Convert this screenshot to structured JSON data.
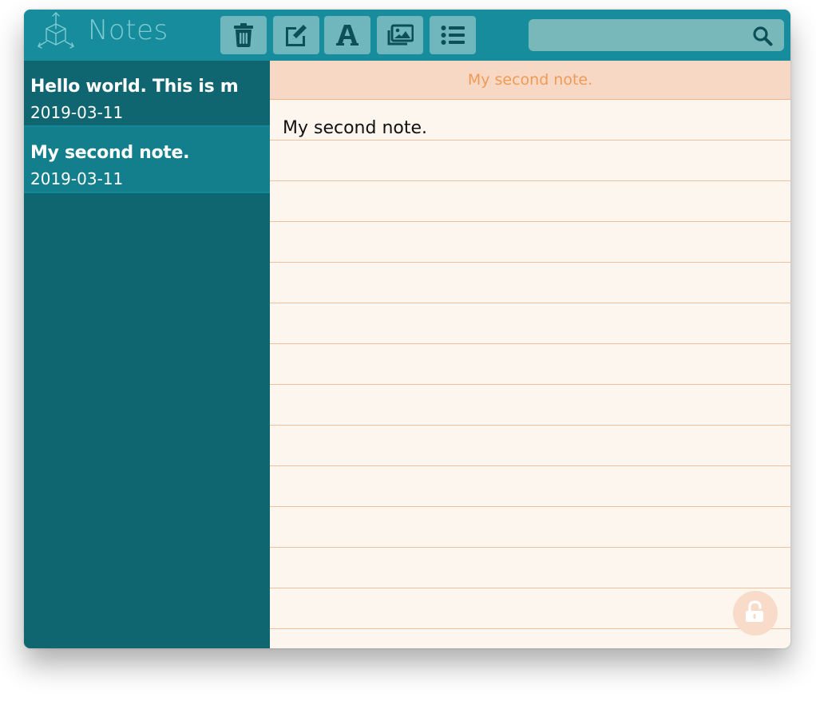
{
  "app": {
    "title": "Notes",
    "accent": "#168c9c",
    "sidebar_bg": "#106670"
  },
  "toolbar": {
    "buttons": [
      {
        "icon": "trash-icon",
        "action": "delete"
      },
      {
        "icon": "edit-icon",
        "action": "edit"
      },
      {
        "icon": "font-icon",
        "action": "font"
      },
      {
        "icon": "images-icon",
        "action": "images"
      },
      {
        "icon": "list-icon",
        "action": "list"
      }
    ]
  },
  "search": {
    "value": "",
    "placeholder": "",
    "icon": "search-icon"
  },
  "notes": [
    {
      "title": "Hello world. This is m",
      "date": "2019-03-11",
      "active": false
    },
    {
      "title": "My second note.",
      "date": "2019-03-11",
      "active": true
    }
  ],
  "editor": {
    "title": "My second note.",
    "body": "My second note.",
    "title_color": "#f09a55",
    "lock_icon": "unlock-icon"
  }
}
